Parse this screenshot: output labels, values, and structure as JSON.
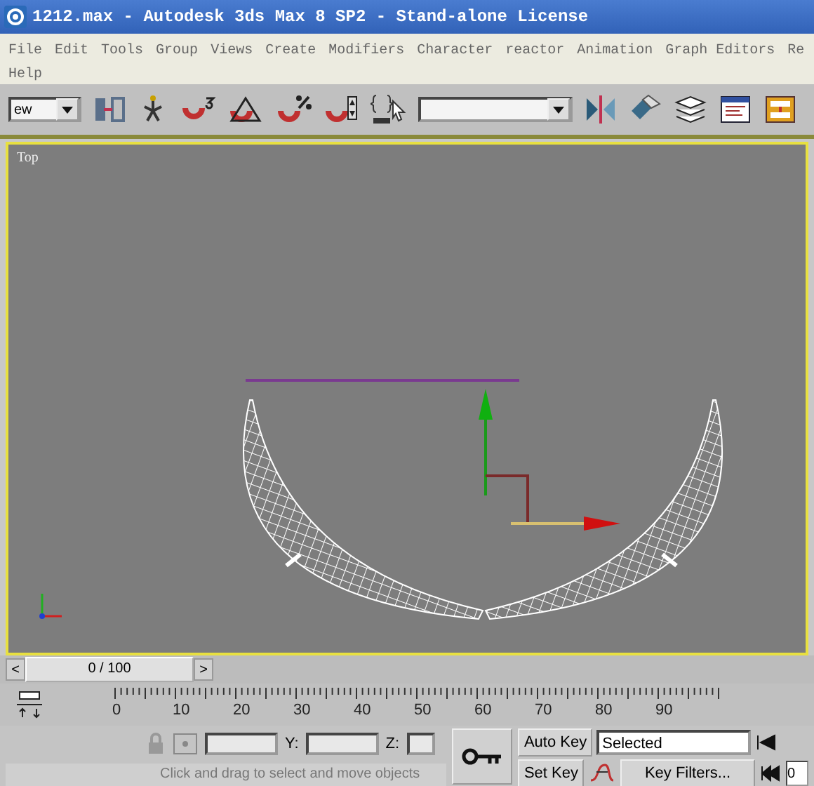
{
  "window": {
    "title": "1212.max - Autodesk 3ds Max 8 SP2  - Stand-alone License"
  },
  "menu": [
    "File",
    "Edit",
    "Tools",
    "Group",
    "Views",
    "Create",
    "Modifiers",
    "Character",
    "reactor",
    "Animation",
    "Graph Editors",
    "Re",
    "Help"
  ],
  "toolbar": {
    "coordinate_dropdown": "ew"
  },
  "viewport": {
    "label": "Top"
  },
  "time_slider": {
    "position": "0 / 100",
    "prev": "<",
    "next": ">"
  },
  "track_bar": {
    "labels": [
      "0",
      "10",
      "20",
      "30",
      "40",
      "50",
      "60",
      "70",
      "80",
      "90"
    ]
  },
  "coordinates": {
    "y_label": "Y:",
    "z_label": "Z:"
  },
  "status": {
    "prompt": "Click and drag to select and move objects"
  },
  "animation": {
    "auto_key": "Auto Key",
    "set_key": "Set Key",
    "key_mode": "Selected",
    "key_filters": "Key Filters...",
    "frame": "0"
  }
}
